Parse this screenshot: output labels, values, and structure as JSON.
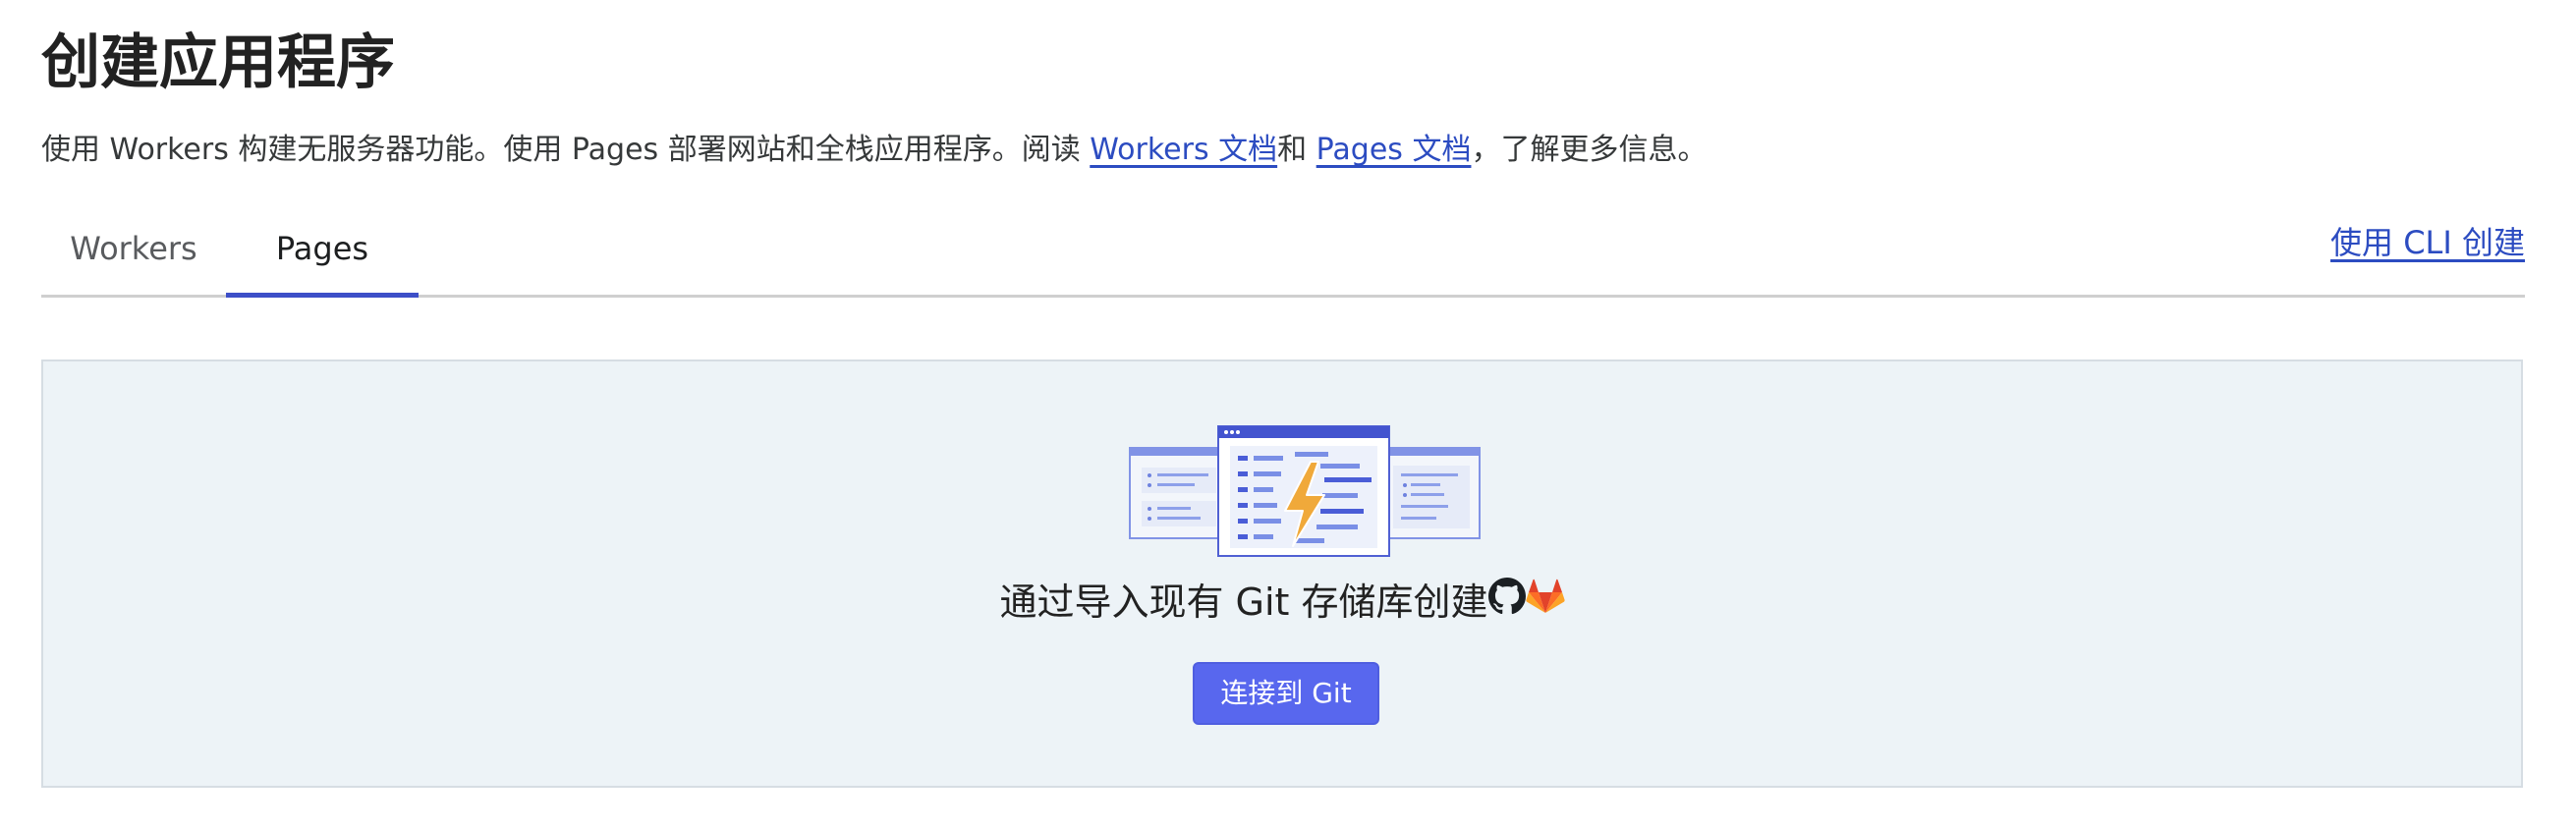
{
  "header": {
    "title": "创建应用程序"
  },
  "description": {
    "text_before": "使用 Workers 构建无服务器功能。使用 Pages 部署网站和全栈应用程序。阅读 ",
    "workers_link": "Workers 文档",
    "text_between": "和 ",
    "pages_link": "Pages 文档",
    "text_after": "，了解更多信息。"
  },
  "tabs": [
    {
      "label": "Workers",
      "active": false
    },
    {
      "label": "Pages",
      "active": true
    }
  ],
  "cli_link": "使用 CLI 创建",
  "import_card": {
    "headline": "通过导入现有 Git 存储库创建",
    "icons": [
      "github-icon",
      "gitlab-icon"
    ],
    "button_label": "连接到 Git"
  },
  "colors": {
    "link": "#2c4cc1",
    "tab_indicator": "#3d4fc8",
    "button_bg": "#5867ee",
    "card_bg": "#edf3f7",
    "lightning": "#f0a93a",
    "gitlab": "#e2662e"
  }
}
